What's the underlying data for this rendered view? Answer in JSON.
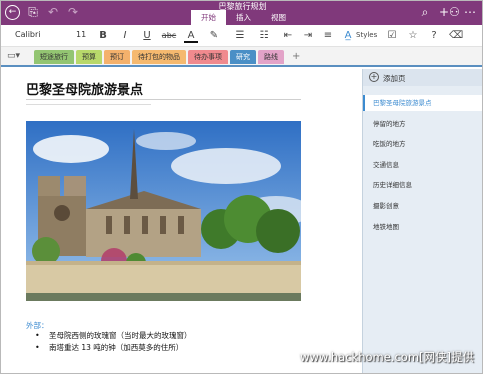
{
  "title_bar": {
    "document_title": "巴黎旅行规划",
    "ribbon_tabs": [
      {
        "label": "开始",
        "active": true
      },
      {
        "label": "插入",
        "active": false
      },
      {
        "label": "视图",
        "active": false
      }
    ],
    "icons": [
      "back-icon",
      "notebook-icon",
      "undo-icon",
      "redo-icon",
      "search-icon",
      "add-person-icon",
      "more-icon"
    ]
  },
  "toolbar": {
    "font_name": "Calibri",
    "font_size": "11",
    "styles_label": "Styles",
    "bold_glyph": "B",
    "italic_glyph": "I",
    "underline_glyph": "U",
    "strike_glyph": "abc",
    "font_color_glyph": "A"
  },
  "sections": {
    "items": [
      {
        "label": "短途旅行",
        "color": "#93c572",
        "active": false
      },
      {
        "label": "预算",
        "color": "#b8d86b",
        "active": false
      },
      {
        "label": "预订",
        "color": "#f4b16c",
        "active": false
      },
      {
        "label": "待打包的物品",
        "color": "#f5b96f",
        "active": false
      },
      {
        "label": "待办事项",
        "color": "#f08a8e",
        "active": false
      },
      {
        "label": "研究",
        "color": "#4a8fc6",
        "active": true
      },
      {
        "label": "路线",
        "color": "#e3a3c8",
        "active": false
      }
    ],
    "add_label": "+"
  },
  "page": {
    "title": "巴黎圣母院旅游景点",
    "section_heading": "外部：",
    "bullets": [
      "圣母院西侧的玫瑰窗（当时最大的玫瑰窗）",
      "南塔重达 13 吨的钟（加西莫多的住所）"
    ]
  },
  "page_list": {
    "add_page_label": "添加页",
    "pages": [
      {
        "label": "巴黎圣母院旅游景点",
        "active": true
      },
      {
        "label": "停留的地方",
        "active": false
      },
      {
        "label": "吃饭的地方",
        "active": false
      },
      {
        "label": "交通信息",
        "active": false
      },
      {
        "label": "历史详细信息",
        "active": false
      },
      {
        "label": "摄影创意",
        "active": false
      },
      {
        "label": "地铁地图",
        "active": false
      }
    ]
  },
  "watermark": "www.hackhome.com[网侠]提供",
  "colors": {
    "brand_purple": "#80397b",
    "accent_blue": "#3c8bd0",
    "pane_background": "#e6edf4"
  }
}
